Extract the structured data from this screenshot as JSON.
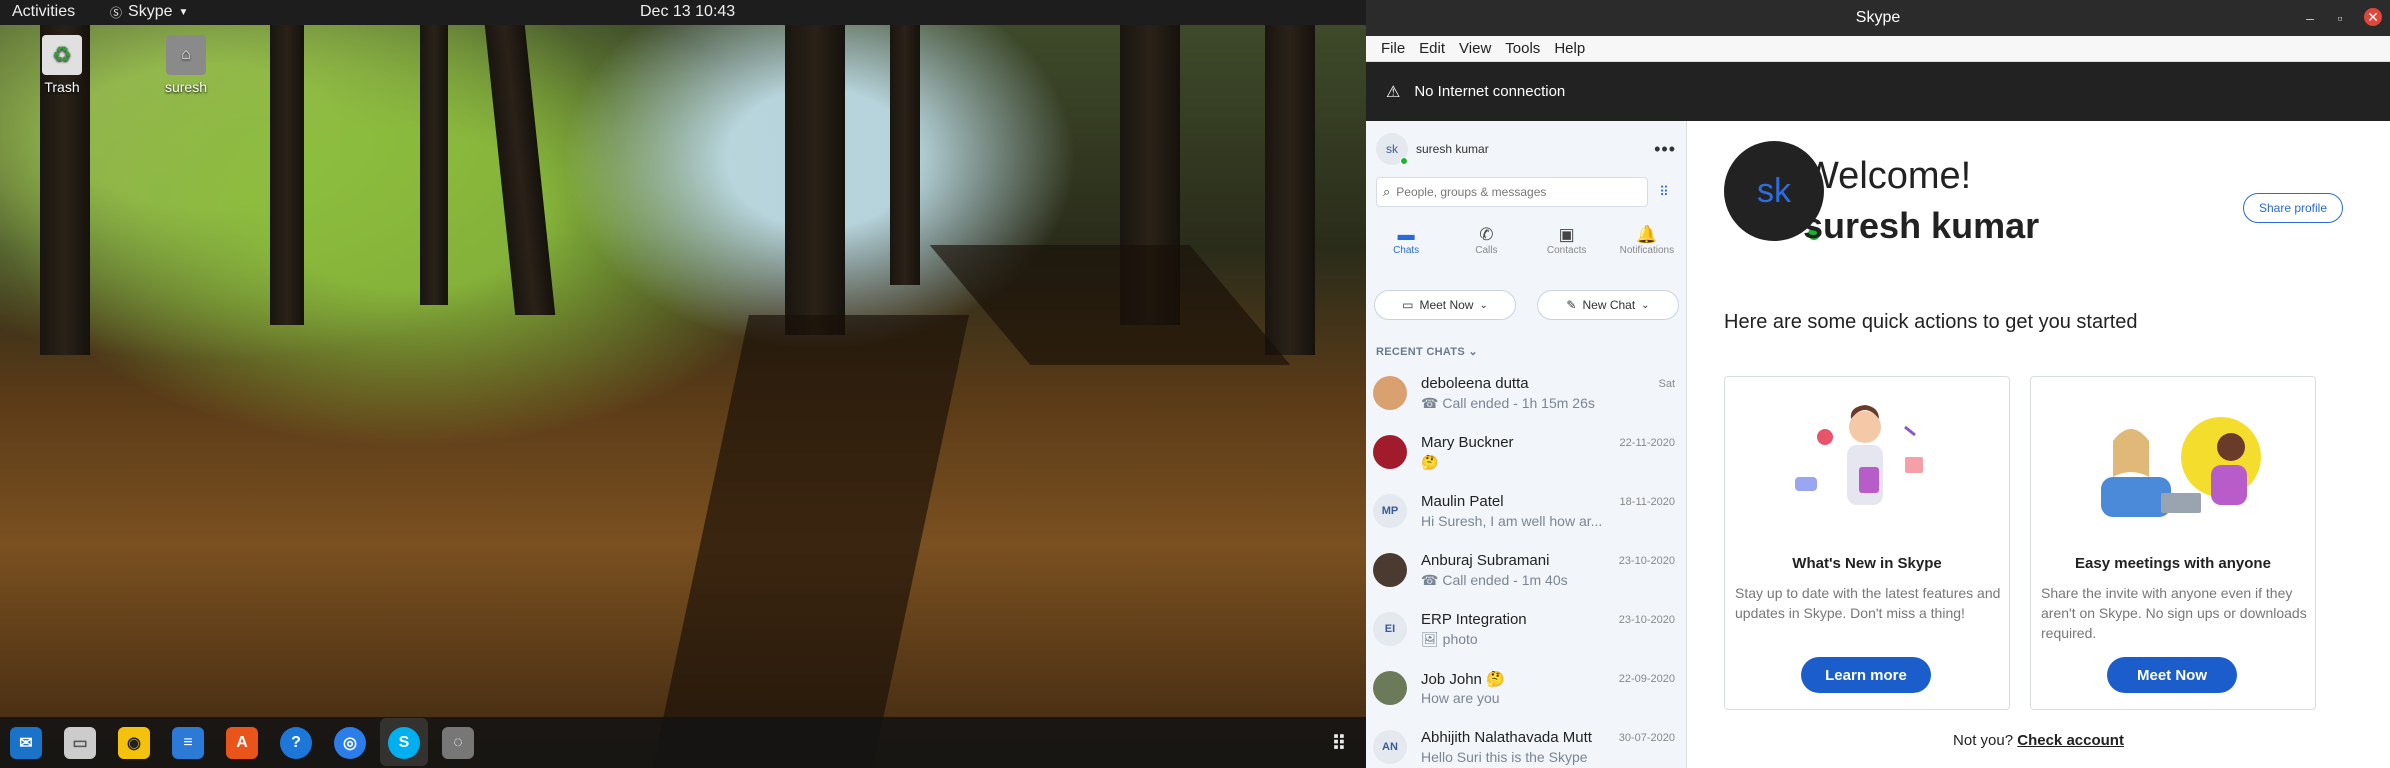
{
  "topbar": {
    "activities": "Activities",
    "app_menu": "Skype",
    "clock": "Dec 13  10:43"
  },
  "desktop": {
    "icons": [
      {
        "label": "Trash"
      },
      {
        "label": "suresh"
      }
    ]
  },
  "window": {
    "title": "Skype"
  },
  "menu": [
    "File",
    "Edit",
    "View",
    "Tools",
    "Help"
  ],
  "banner": {
    "text": "No Internet connection"
  },
  "sidebar": {
    "profile_initials": "sk",
    "profile_name": "suresh kumar",
    "search_placeholder": "People, groups & messages",
    "tabs": [
      "Chats",
      "Calls",
      "Contacts",
      "Notifications"
    ],
    "meet_now": "Meet Now",
    "new_chat": "New Chat",
    "recent_header": "RECENT CHATS",
    "chats": [
      {
        "name": "deboleena dutta",
        "message": "Call ended - 1h 15m 26s",
        "date": "Sat",
        "initials": ""
      },
      {
        "name": "Mary Buckner",
        "message": "🤔",
        "date": "22-11-2020",
        "initials": ""
      },
      {
        "name": "Maulin Patel",
        "message": "Hi Suresh, I am well how ar...",
        "date": "18-11-2020",
        "initials": "MP"
      },
      {
        "name": "Anburaj Subramani",
        "message": "Call ended - 1m 40s",
        "date": "23-10-2020",
        "initials": ""
      },
      {
        "name": "ERP Integration",
        "message": "photo",
        "date": "23-10-2020",
        "initials": "EI"
      },
      {
        "name": "Job John 🤔",
        "message": "How are you",
        "date": "22-09-2020",
        "initials": ""
      },
      {
        "name": "Abhijith Nalathavada Mutt",
        "message": "Hello Suri this is the Skype",
        "date": "30-07-2020",
        "initials": "AN"
      }
    ]
  },
  "main": {
    "avatar_initials": "sk",
    "welcome": "Welcome!",
    "username": "suresh kumar",
    "share_profile": "Share profile",
    "quick_actions": "Here are some quick actions to get you started",
    "cards": [
      {
        "title": "What's New in Skype",
        "description": "Stay up to date with the latest features and updates in Skype. Don't miss a thing!",
        "button": "Learn more"
      },
      {
        "title": "Easy meetings with anyone",
        "description": "Share the invite with anyone even if they aren't on Skype. No sign ups or downloads required.",
        "button": "Meet Now"
      }
    ],
    "not_you": "Not you?",
    "check_account": "Check account"
  }
}
